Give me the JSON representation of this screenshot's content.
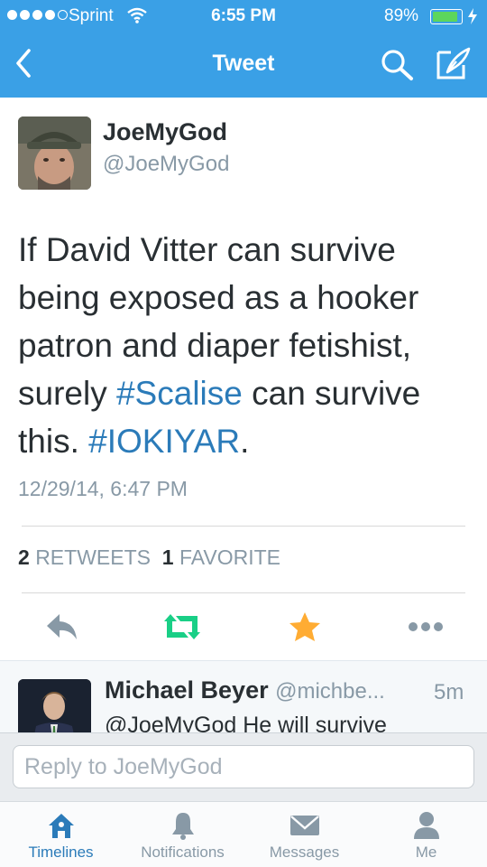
{
  "status_bar": {
    "carrier": "Sprint",
    "time": "6:55 PM",
    "battery_percent": "89%",
    "battery_level": 0.89
  },
  "nav": {
    "title": "Tweet",
    "icons": [
      "back-chevron-icon",
      "search-icon",
      "compose-icon"
    ]
  },
  "tweet": {
    "author_name": "JoeMyGod",
    "author_handle": "@JoeMyGod",
    "text_line1": "If David Vitter can survive",
    "text_line2": "being exposed as a hooker",
    "text_line3": "patron and diaper fetishist,",
    "text_line4_pre": "surely ",
    "hashtag1": "#Scalise",
    "text_line4_post": " can survive",
    "text_line5_pre": "this. ",
    "hashtag2": "#IOKIYAR",
    "text_line5_post": ".",
    "timestamp": "12/29/14, 6:47 PM",
    "retweet_count": "2",
    "retweet_label": "RETWEETS",
    "favorite_count": "1",
    "favorite_label": "FAVORITE",
    "colors": {
      "hashtag": "#2b7bb9",
      "retweet_icon": "#19cf86",
      "favorite_icon": "#ffac33"
    },
    "action_icons": [
      "reply-icon",
      "retweet-icon",
      "favorite-star-icon",
      "more-dots-icon"
    ]
  },
  "reply": {
    "author_name": "Michael Beyer",
    "author_handle": "@michbe...",
    "age": "5m",
    "text": "@JoeMyGod He will survive"
  },
  "composer": {
    "placeholder": "Reply to JoeMyGod"
  },
  "tabbar": {
    "tabs": [
      {
        "label": "Timelines",
        "icon": "home-icon",
        "active": true
      },
      {
        "label": "Notifications",
        "icon": "bell-icon",
        "active": false
      },
      {
        "label": "Messages",
        "icon": "envelope-icon",
        "active": false
      },
      {
        "label": "Me",
        "icon": "person-icon",
        "active": false
      }
    ]
  },
  "colors": {
    "brand_blue": "#3aa0e6",
    "link_blue": "#2b7bb9",
    "muted_text": "#8899a6"
  }
}
